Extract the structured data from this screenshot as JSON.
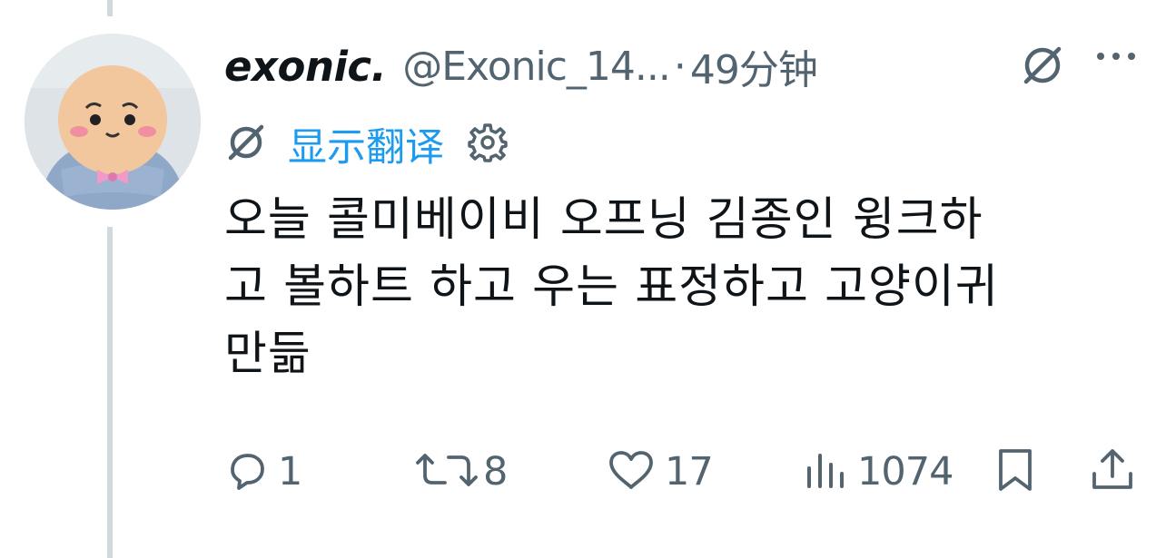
{
  "tweet": {
    "display_name": "exonic.",
    "handle": "@Exonic_14...",
    "separator": "·",
    "time": "49分钟",
    "translate_label": "显示翻译",
    "text_lines": [
      "오늘 콜미베이비 오프닝 김종인 윙크하",
      "고 볼하트 하고 우는 표정하고 고양이귀",
      "만듦"
    ]
  },
  "actions": {
    "replies": "1",
    "reposts": "8",
    "likes": "17",
    "views": "1074"
  },
  "icons": {
    "grok": "slashed-circle-icon",
    "more": "more-horizontal-icon",
    "settings": "gear-icon",
    "reply": "reply-bubble-icon",
    "repost": "repost-arrows-icon",
    "like": "heart-icon",
    "views": "bar-chart-icon",
    "bookmark": "bookmark-icon",
    "share": "share-icon"
  },
  "colors": {
    "text": "#0f1419",
    "secondary": "#536471",
    "link": "#1d9bf0",
    "thread_line": "#cfd9de"
  }
}
